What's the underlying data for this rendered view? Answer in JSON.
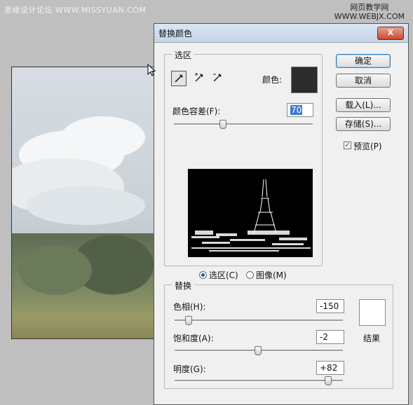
{
  "watermark_left": "思缘设计论坛 WWW.MISSYUAN.COM",
  "watermark_right_line1": "网页教学网",
  "watermark_right_line2": "WWW.WEBJX.COM",
  "dialog": {
    "title": "替换颜色",
    "close_glyph": "X",
    "buttons": {
      "ok": "确定",
      "cancel": "取消",
      "load": "载入(L)...",
      "save": "存储(S)..."
    },
    "preview_checkbox": {
      "label": "预览(P)",
      "checked": true
    },
    "selection": {
      "legend": "选区",
      "color_label": "颜色:",
      "color_swatch": "#2a2d2c",
      "fuzziness_label": "颜色容差(F):",
      "fuzziness_value": "70",
      "fuzziness_fraction": 0.35,
      "radio_selection": "选区(C)",
      "radio_image": "图像(M)",
      "selected_radio": "selection"
    },
    "replace": {
      "legend": "替换",
      "hue_label": "色相(H):",
      "hue_value": "-150",
      "hue_fraction": 0.08,
      "saturation_label": "饱和度(A):",
      "saturation_value": "-2",
      "saturation_fraction": 0.49,
      "lightness_label": "明度(G):",
      "lightness_value": "+82",
      "lightness_fraction": 0.91,
      "result_label": "结果",
      "result_color": "#ffffff"
    }
  }
}
